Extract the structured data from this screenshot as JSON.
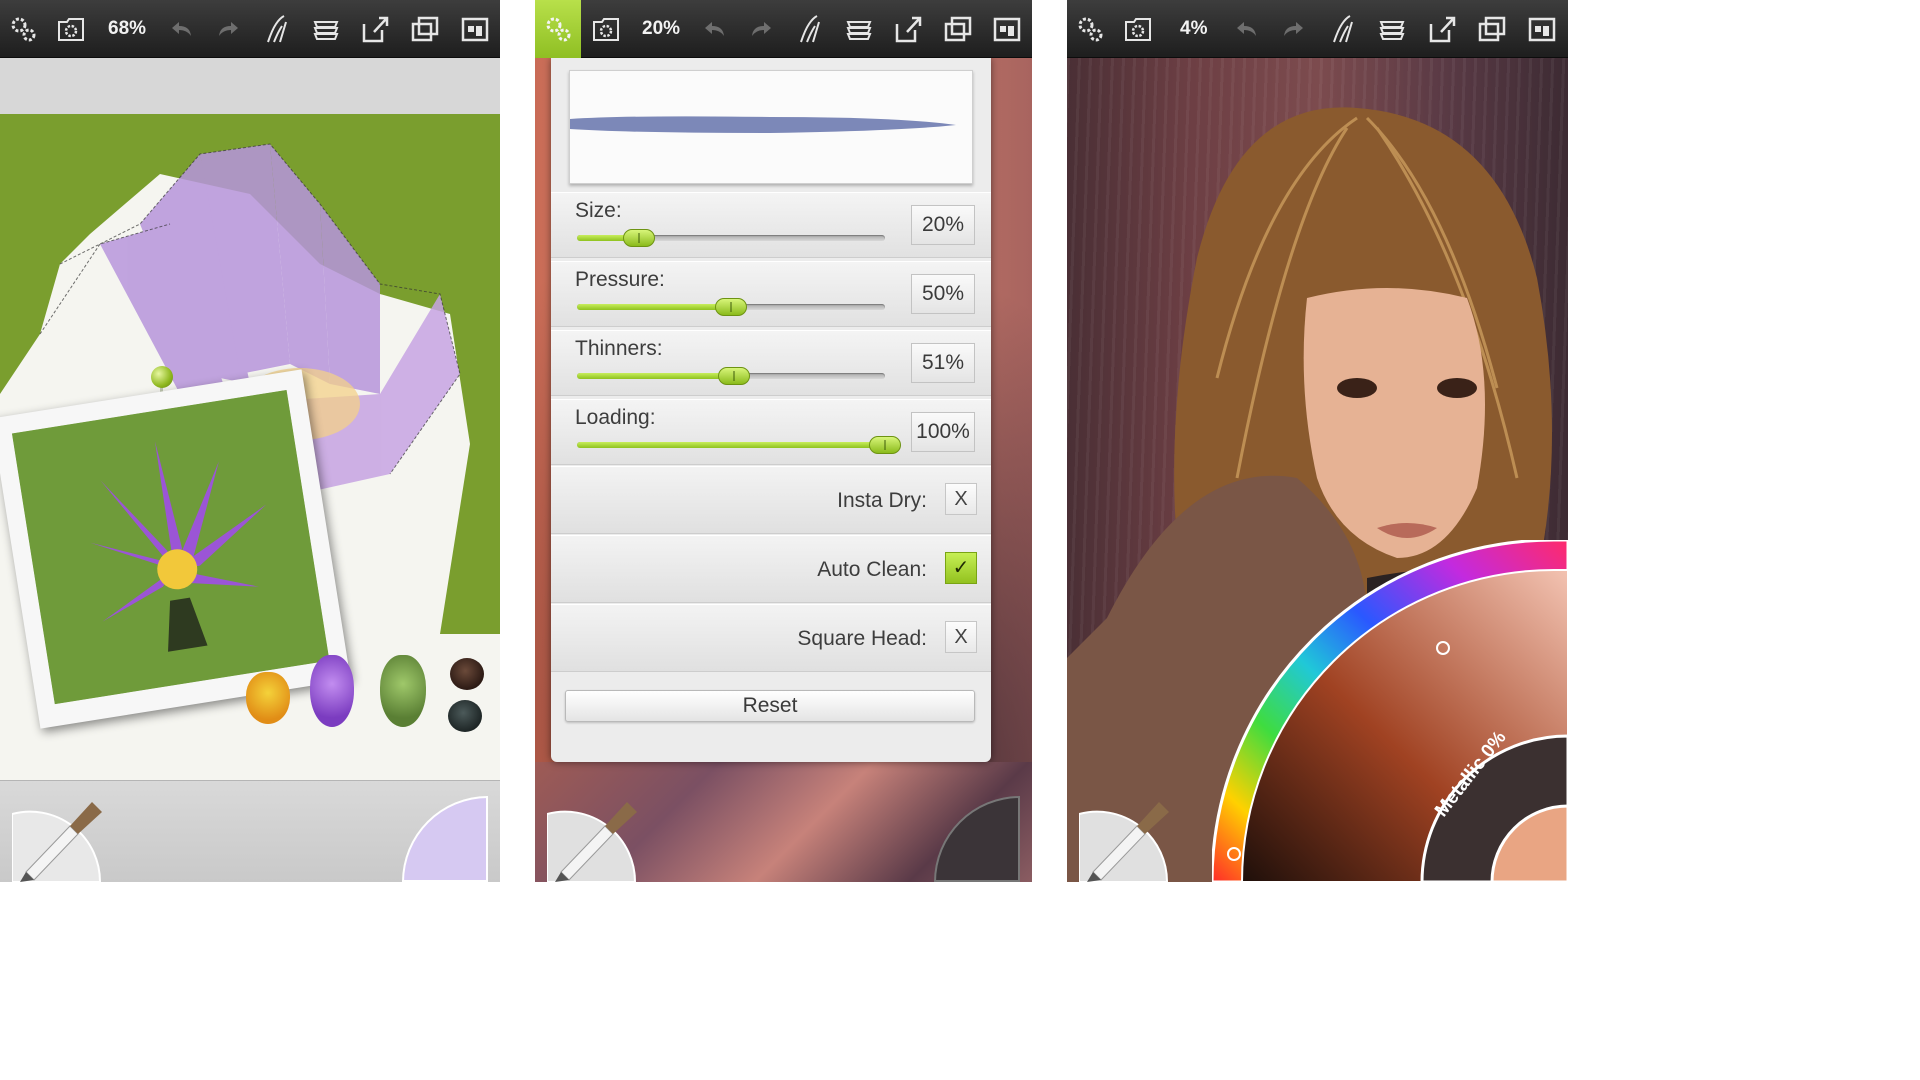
{
  "toolbar": {
    "icons": [
      "gears-icon",
      "folder-gear-icon",
      "undo-icon",
      "redo-icon",
      "brush-style-icon",
      "layers-icon",
      "export-icon",
      "windows-icon",
      "gallery-icon"
    ]
  },
  "screens": [
    {
      "zoom": "68%"
    },
    {
      "zoom": "20%"
    },
    {
      "zoom": "4%"
    }
  ],
  "brush_settings": {
    "sliders": [
      {
        "label": "Size:",
        "value": "20%",
        "level": 0.2
      },
      {
        "label": "Pressure:",
        "value": "50%",
        "level": 0.5
      },
      {
        "label": "Thinners:",
        "value": "51%",
        "level": 0.51
      },
      {
        "label": "Loading:",
        "value": "100%",
        "level": 1.0
      }
    ],
    "toggles": [
      {
        "label": "Insta Dry:",
        "mark": "X",
        "checked": false
      },
      {
        "label": "Auto Clean:",
        "mark": "✓",
        "checked": true
      },
      {
        "label": "Square Head:",
        "mark": "X",
        "checked": false
      }
    ],
    "reset_label": "Reset",
    "stroke_color": "#6e7bb0"
  },
  "palette": {
    "metallic_label": "Metallic 0%",
    "current_color": "#e9a583"
  },
  "colors": {
    "accent": "#9ccc2c",
    "screen1_puck": "#d6c9f2",
    "screen2_puck": "#3b3438"
  }
}
